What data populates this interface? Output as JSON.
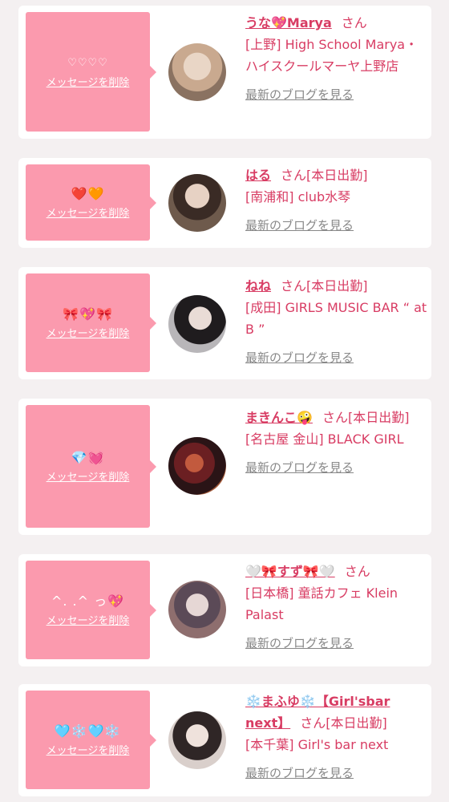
{
  "delete_label": "メッセージを削除",
  "blog_label": "最新のブログを見る",
  "san": "さん",
  "colors": {
    "accent": "#d83c63",
    "message_box": "#fb9aae",
    "card": "#ffffff",
    "background": "#f4f0f1",
    "muted": "#888888"
  },
  "items": [
    {
      "message": "♡♡♡♡",
      "name": "うな💖Marya",
      "status": "",
      "shop": "[上野] High School Marya・ハイスクールマーヤ上野店"
    },
    {
      "message": "❤️🧡",
      "name": "はる",
      "status": "[本日出勤]",
      "shop": "[南浦和] club水琴"
    },
    {
      "message": "🎀💖🎀",
      "name": "ねね",
      "status": "[本日出勤]",
      "shop": "[成田] GIRLS MUSIC BAR “ at B ”"
    },
    {
      "message": "💎💓",
      "name": "まきんこ🤪",
      "status": "[本日出勤]",
      "shop": "[名古屋 金山] BLACK GIRL"
    },
    {
      "message": "^. .^ っ💖",
      "name": "🤍🎀すず🎀🤍",
      "status": "",
      "shop": "[日本橋] 童話カフェ Klein Palast"
    },
    {
      "message": "🩵❄️🩵❄️",
      "name": "❄️まふゆ❄️【Girl'sbar next】",
      "status": "[本日出勤]",
      "shop": "[本千葉] Girl's bar next"
    }
  ]
}
